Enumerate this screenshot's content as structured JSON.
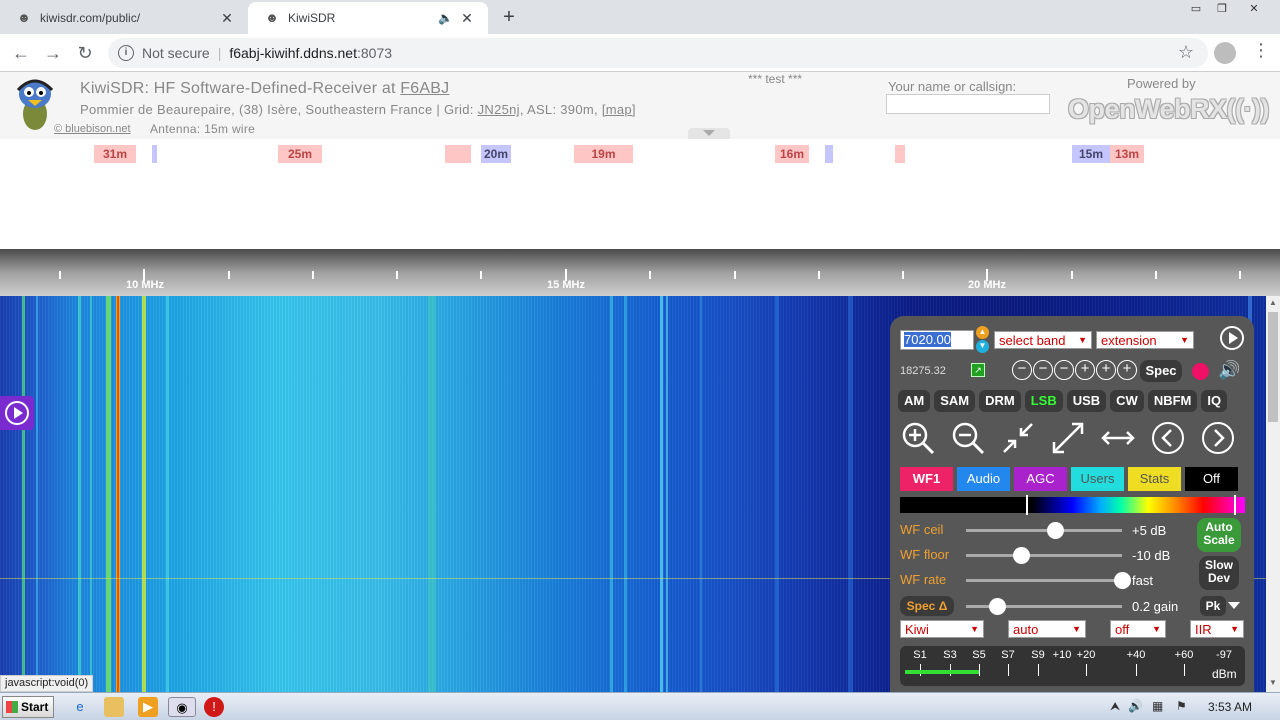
{
  "browser": {
    "tabs": [
      {
        "title": "kiwisdr.com/public/"
      },
      {
        "title": "KiwiSDR"
      }
    ],
    "url": {
      "secure_label": "Not secure",
      "host": "f6abj-kiwihf.ddns.net",
      "port": ":8073"
    }
  },
  "header": {
    "title_prefix": "KiwiSDR: HF Software-Defined-Receiver at ",
    "callsign": "F6ABJ",
    "location_prefix": "Pommier de Beaurepaire, (38) Isère, Southeastern France | Grid: ",
    "grid": "JN25nj",
    "location_suffix": ", ASL: 390m, ",
    "map_link": "[map]",
    "credit": "© bluebison.net",
    "antenna": "Antenna: 15m wire",
    "test_banner": "*** test ***",
    "name_label": "Your name or callsign:",
    "name_value": "",
    "powered_by": "Powered by",
    "brand": "OpenWebRX"
  },
  "bands": [
    {
      "label": "31m",
      "kind": "pink"
    },
    {
      "label": "",
      "kind": "blue"
    },
    {
      "label": "25m",
      "kind": "pink"
    },
    {
      "label": "",
      "kind": "pink"
    },
    {
      "label": "20m",
      "kind": "blue"
    },
    {
      "label": "19m",
      "kind": "pink"
    },
    {
      "label": "16m",
      "kind": "pink"
    },
    {
      "label": "",
      "kind": "blue"
    },
    {
      "label": "",
      "kind": "pink"
    },
    {
      "label": "15m",
      "kind": "blue"
    },
    {
      "label": "13m",
      "kind": "pink"
    }
  ],
  "scale": {
    "labels": [
      "10 MHz",
      "15 MHz",
      "20 MHz"
    ]
  },
  "status_url": "javascript:void(0)",
  "panel": {
    "frequency": "7020.00",
    "band_select": "select band",
    "extension_select": "extension",
    "freq_readout": "18275.32",
    "spec_label": "Spec",
    "modes": [
      "AM",
      "SAM",
      "DRM",
      "LSB",
      "USB",
      "CW",
      "NBFM",
      "IQ"
    ],
    "active_mode": "LSB",
    "tabs": [
      {
        "label": "WF1",
        "bg": "#ee2266",
        "fg": "#ffffff"
      },
      {
        "label": "Audio",
        "bg": "#2288ee",
        "fg": "#ffffff"
      },
      {
        "label": "AGC",
        "bg": "#aa22cc",
        "fg": "#ffffff"
      },
      {
        "label": "Users",
        "bg": "#22dddd",
        "fg": "#555555"
      },
      {
        "label": "Stats",
        "bg": "#eedd22",
        "fg": "#555555"
      },
      {
        "label": "Off",
        "bg": "#000000",
        "fg": "#ffffff"
      }
    ],
    "sliders": {
      "wf_ceil": {
        "label": "WF ceil",
        "value": "+5 dB",
        "level": 0.57
      },
      "wf_floor": {
        "label": "WF floor",
        "value": "-10 dB",
        "level": 0.35
      },
      "wf_rate": {
        "label": "WF rate",
        "value": "fast",
        "level": 1.0
      },
      "spec_delta": {
        "label": "Spec Δ",
        "value": "0.2 gain",
        "level": 0.2
      }
    },
    "auto_scale": "Auto Scale",
    "slow_dev": "Slow Dev",
    "pk": "Pk",
    "bottom_selects": [
      "Kiwi",
      "auto",
      "off",
      "IIR"
    ],
    "smeter": {
      "labels": [
        "S1",
        "S3",
        "S5",
        "S7",
        "S9",
        "+10",
        "+20",
        "+40",
        "+60",
        "-97"
      ],
      "unit": "dBm",
      "level": 0.22
    }
  },
  "taskbar": {
    "start": "Start",
    "clock": "3:53 AM"
  }
}
